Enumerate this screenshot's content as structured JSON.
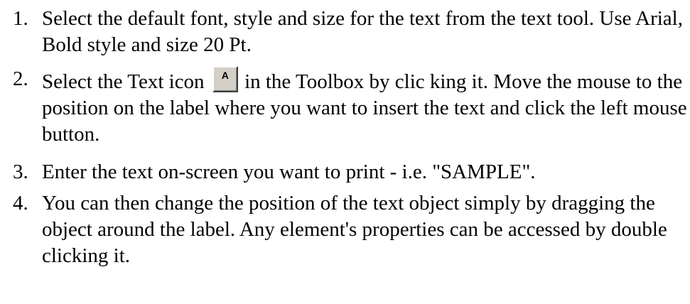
{
  "steps": [
    {
      "number": "1.",
      "text": "Select the default font, style and size for the text from the text tool. Use Arial, Bold style and size 20 Pt."
    },
    {
      "number": "2.",
      "text_before": "Select the Text icon",
      "icon": {
        "name": "text-tool-icon",
        "glyph": "A"
      },
      "text_after": "in the Toolbox by clic king it. Move the mouse to the position on the label where you want to insert the text and click the left mouse button."
    },
    {
      "number": "3.",
      "text": "Enter the text on-screen you want to print - i.e. \"SAMPLE\"."
    },
    {
      "number": "4.",
      "text": "You can then change the position of the text object simply by dragging the object around the label. Any element's properties can be accessed by double clicking it."
    }
  ]
}
